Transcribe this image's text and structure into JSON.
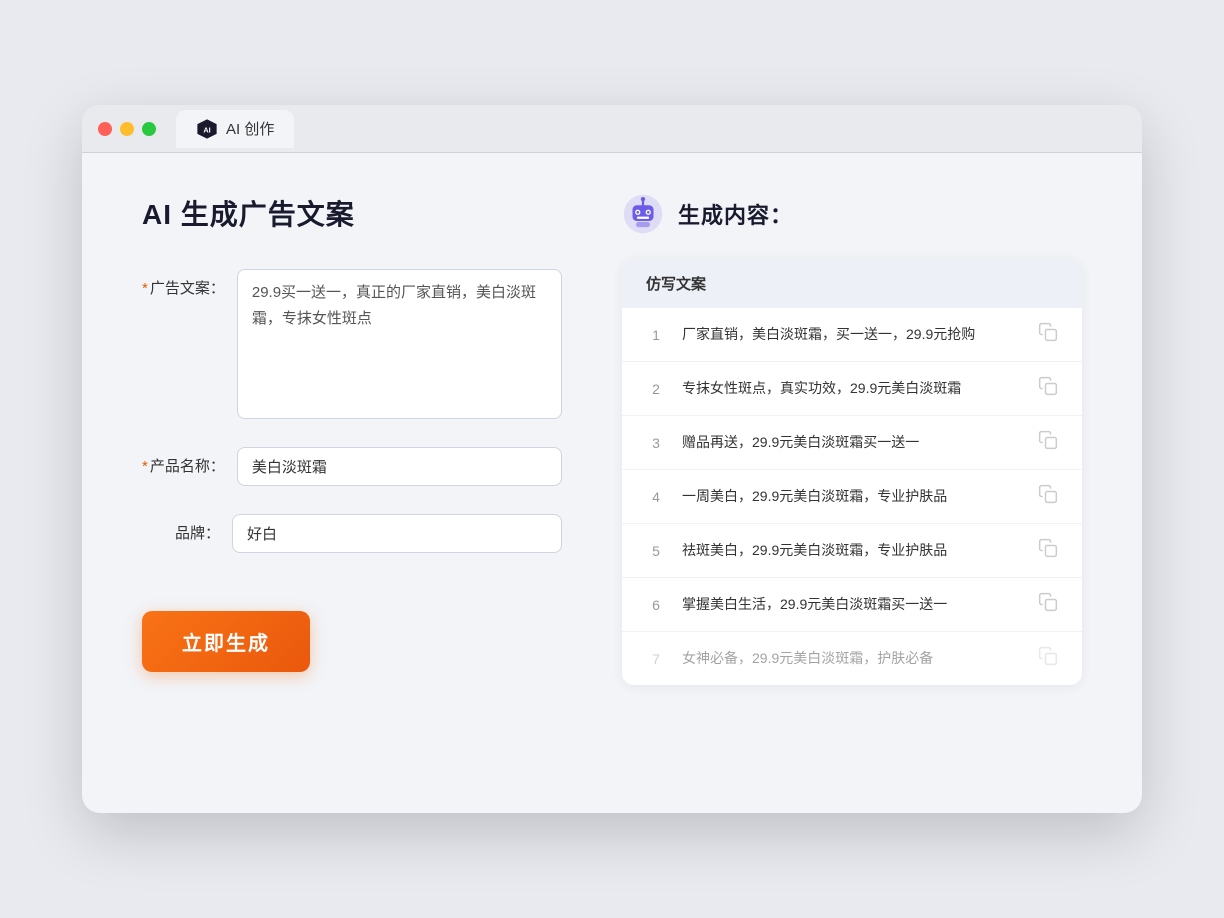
{
  "browser": {
    "tab_label": "AI 创作"
  },
  "page": {
    "title": "AI 生成广告文案",
    "form": {
      "ad_copy_label": "广告文案：",
      "ad_copy_required": "*",
      "ad_copy_value": "29.9买一送一，真正的厂家直销，美白淡斑霜，专抹女性斑点",
      "product_name_label": "产品名称：",
      "product_name_required": "*",
      "product_name_value": "美白淡斑霜",
      "brand_label": "品牌：",
      "brand_value": "好白",
      "generate_button_label": "立即生成"
    },
    "results": {
      "header_icon": "robot",
      "header_title": "生成内容：",
      "table_header": "仿写文案",
      "items": [
        {
          "num": "1",
          "text": "厂家直销，美白淡斑霜，买一送一，29.9元抢购",
          "faded": false
        },
        {
          "num": "2",
          "text": "专抹女性斑点，真实功效，29.9元美白淡斑霜",
          "faded": false
        },
        {
          "num": "3",
          "text": "赠品再送，29.9元美白淡斑霜买一送一",
          "faded": false
        },
        {
          "num": "4",
          "text": "一周美白，29.9元美白淡斑霜，专业护肤品",
          "faded": false
        },
        {
          "num": "5",
          "text": "祛斑美白，29.9元美白淡斑霜，专业护肤品",
          "faded": false
        },
        {
          "num": "6",
          "text": "掌握美白生活，29.9元美白淡斑霜买一送一",
          "faded": false
        },
        {
          "num": "7",
          "text": "女神必备，29.9元美白淡斑霜，护肤必备",
          "faded": true
        }
      ]
    }
  }
}
